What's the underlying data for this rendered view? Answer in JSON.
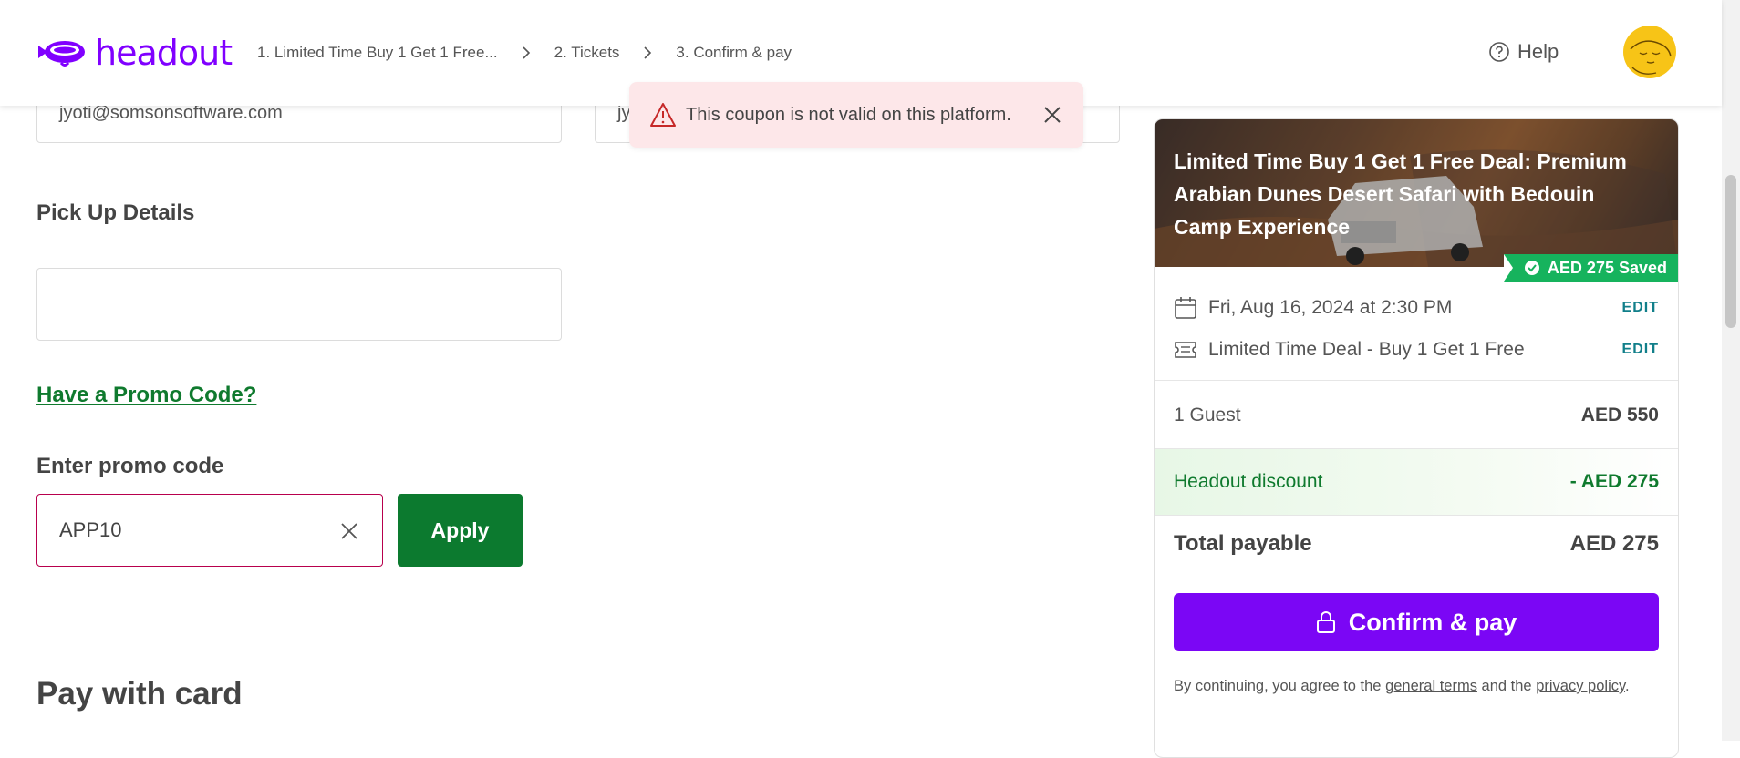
{
  "header": {
    "logo_text": "headout",
    "breadcrumbs": [
      {
        "label": "1. Limited Time Buy 1 Get 1 Free..."
      },
      {
        "label": "2. Tickets"
      },
      {
        "label": "3. Confirm & pay"
      }
    ],
    "help_label": "Help"
  },
  "form": {
    "email_value": "jyoti@somsonsoftware.com",
    "second_field_value": "jy",
    "pickup_label": "Pick Up Details",
    "pickup_value": "",
    "promo_link": "Have a Promo Code?",
    "promo_label": "Enter promo code",
    "promo_value": "APP10",
    "apply_label": "Apply",
    "pay_with_card": "Pay with card"
  },
  "toast": {
    "message": "This coupon is not valid on this platform."
  },
  "summary": {
    "title": "Limited Time Buy 1 Get 1 Free Deal: Premium Arabian Dunes Desert Safari with Bedouin Camp Experience",
    "saved_badge": "AED 275 Saved",
    "date_time": "Fri, Aug 16, 2024 at 2:30 PM",
    "ticket_type": "Limited Time Deal - Buy 1 Get 1 Free",
    "edit_label": "EDIT",
    "guests_label": "1 Guest",
    "guests_price": "AED 550",
    "discount_label": "Headout discount",
    "discount_value": "- AED 275",
    "total_label": "Total payable",
    "total_value": "AED 275",
    "confirm_label": "Confirm & pay",
    "terms_prefix": "By continuing, you agree to the ",
    "terms_link": "general terms",
    "terms_middle": " and the ",
    "privacy_link": "privacy policy",
    "terms_suffix": "."
  },
  "colors": {
    "brand": "#8000ff",
    "confirm": "#7b06f5",
    "apply": "#0c7a2f",
    "discount": "#0f7a2e",
    "edit": "#117f8a",
    "error_border": "#b8004d",
    "toast_bg": "#fde7e9",
    "saved_badge": "#16b35d"
  },
  "icons": {
    "logo": "blimp-icon",
    "breadcrumb_separator": "chevron-right-icon",
    "help": "question-circle-icon",
    "toast": "warning-triangle-icon",
    "close": "close-icon",
    "calendar": "calendar-icon",
    "ticket": "ticket-icon",
    "lock": "lock-icon",
    "saved": "badge-check-icon"
  }
}
